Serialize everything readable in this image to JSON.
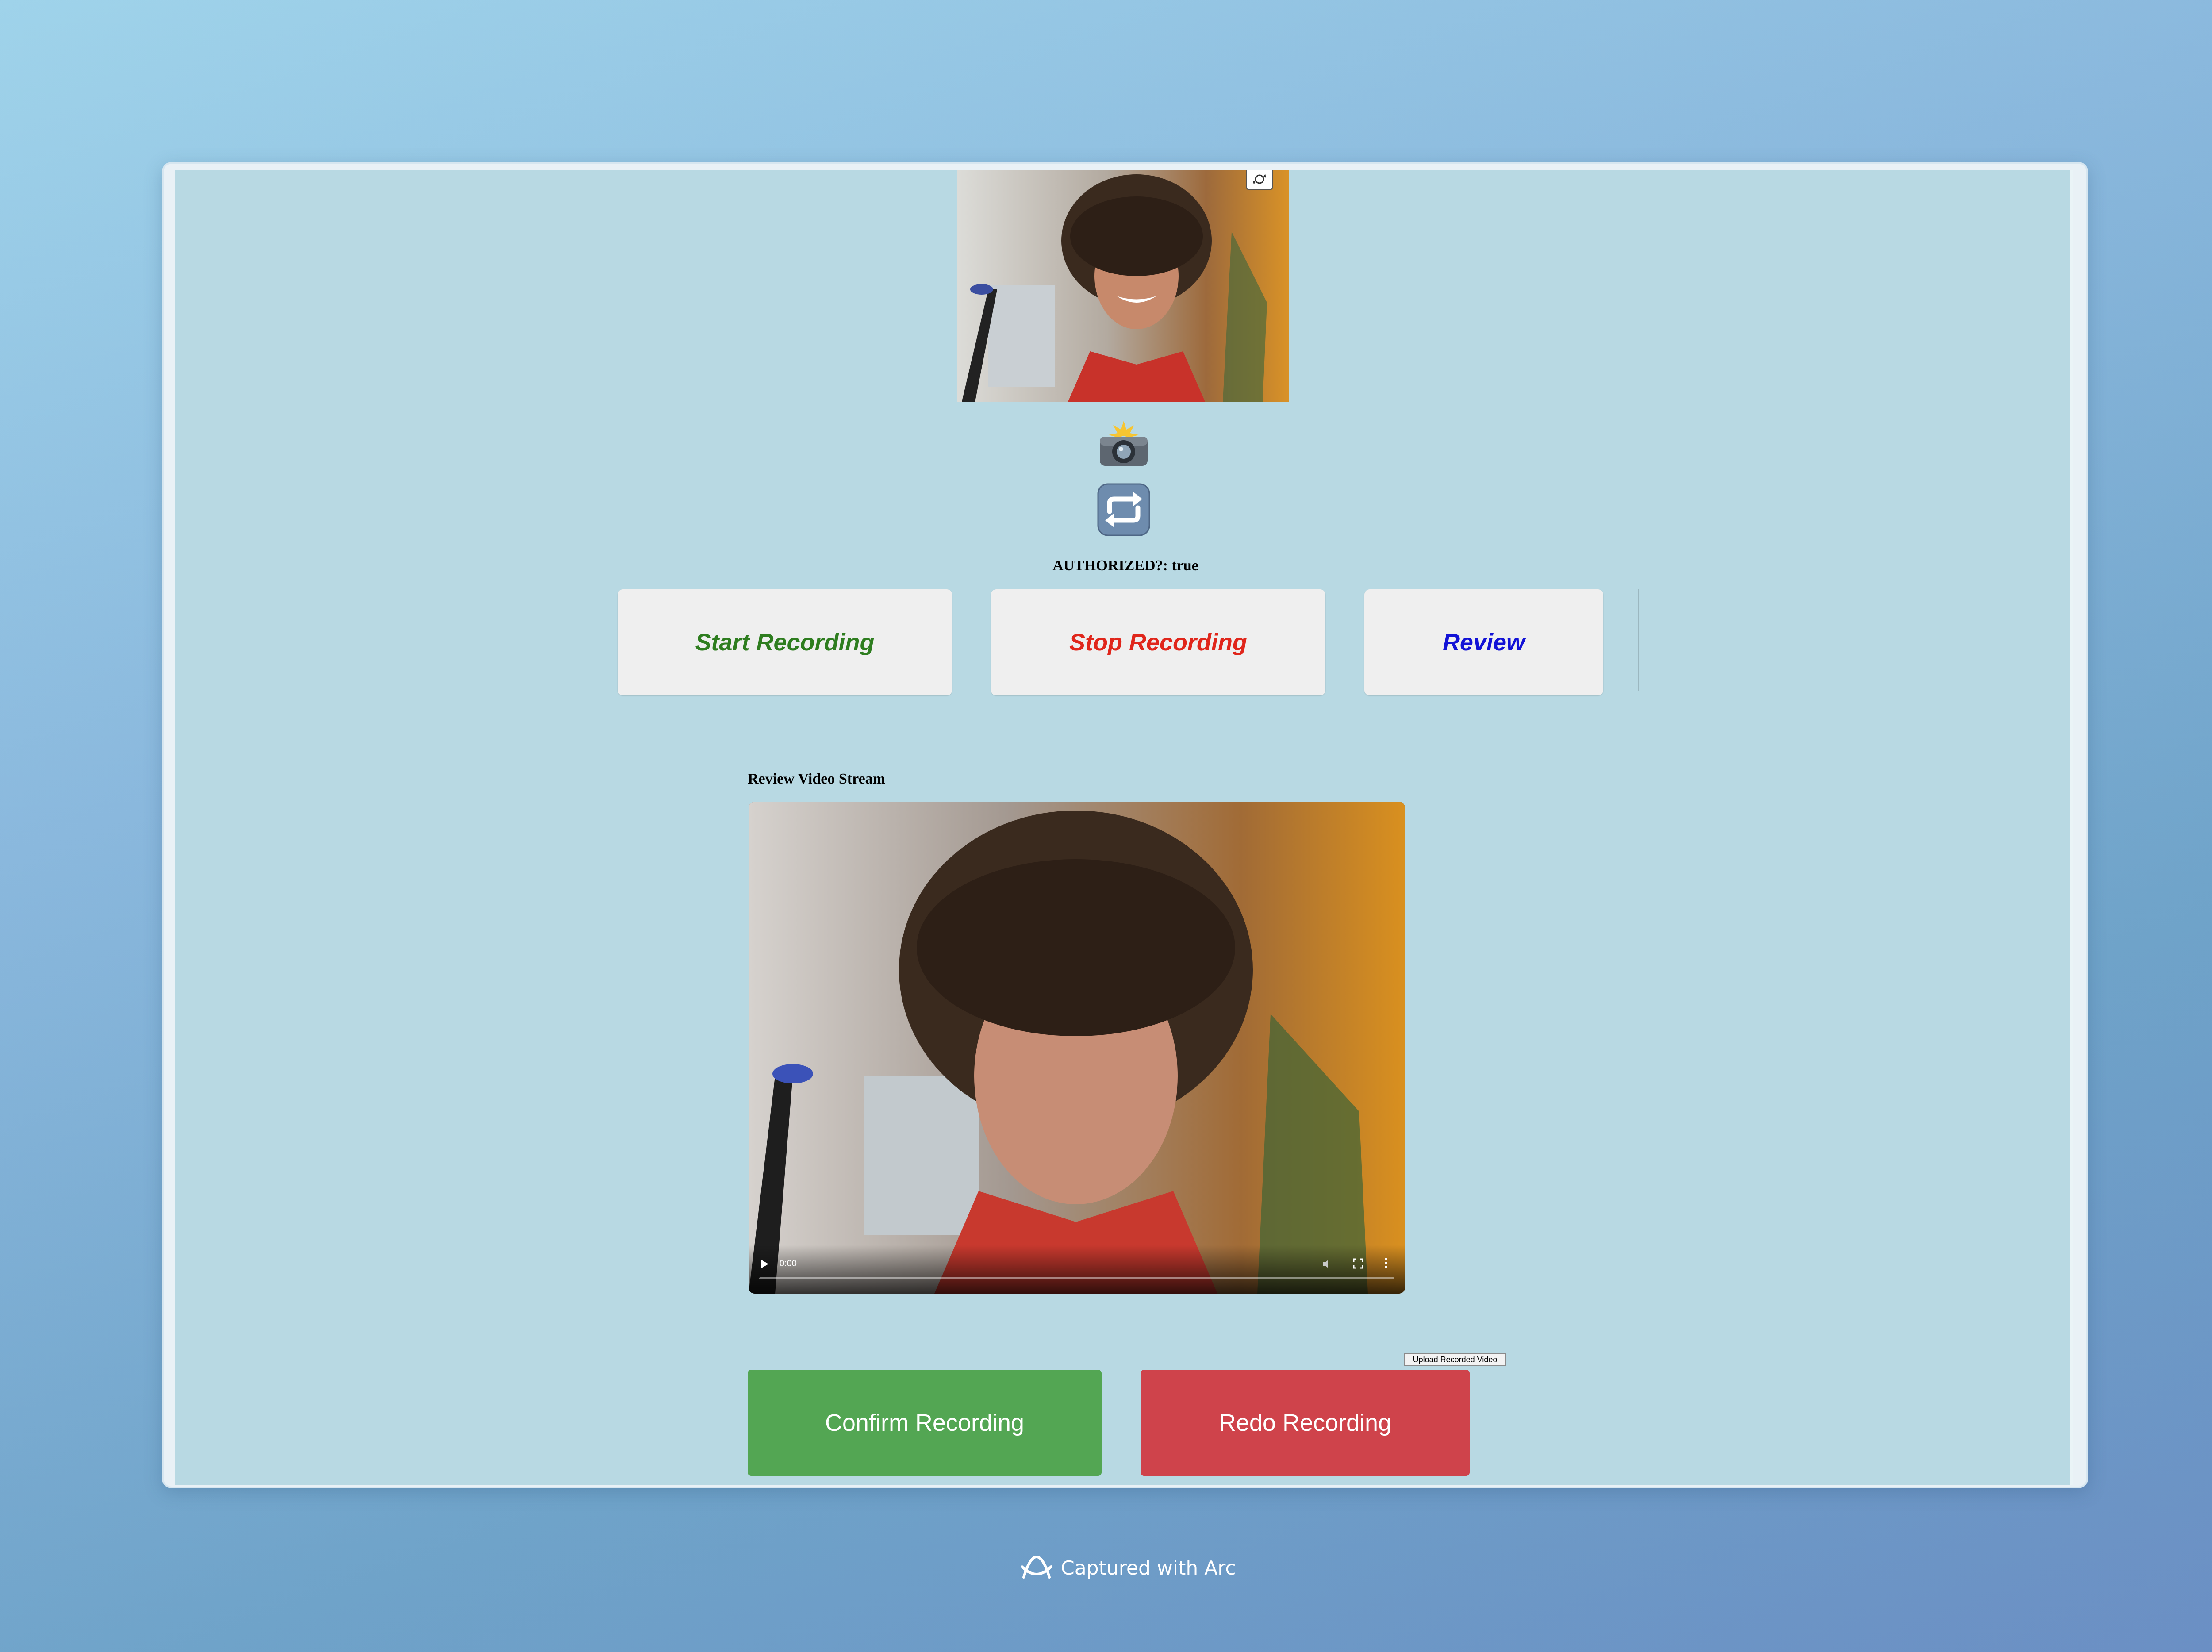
{
  "preview": {
    "flip_icon": "camera-flip-icon"
  },
  "buttons": {
    "capture_icon": "camera-flash-emoji",
    "switch_icon": "repeat-arrows-emoji",
    "start_label": "Start Recording",
    "stop_label": "Stop Recording",
    "review_label": "Review",
    "confirm_label": "Confirm Recording",
    "redo_label": "Redo Recording",
    "upload_label": "Upload Recorded Video"
  },
  "status": {
    "authorized_label": "AUTHORIZED?:",
    "authorized_value": "true"
  },
  "review": {
    "heading": "Review Video Stream",
    "time": "0:00"
  },
  "colors": {
    "start": "#2e7d1f",
    "stop": "#e0261b",
    "review": "#1212d6",
    "confirm": "#53a653",
    "redo": "#cf434b"
  },
  "footer": {
    "text": "Captured with Arc"
  }
}
